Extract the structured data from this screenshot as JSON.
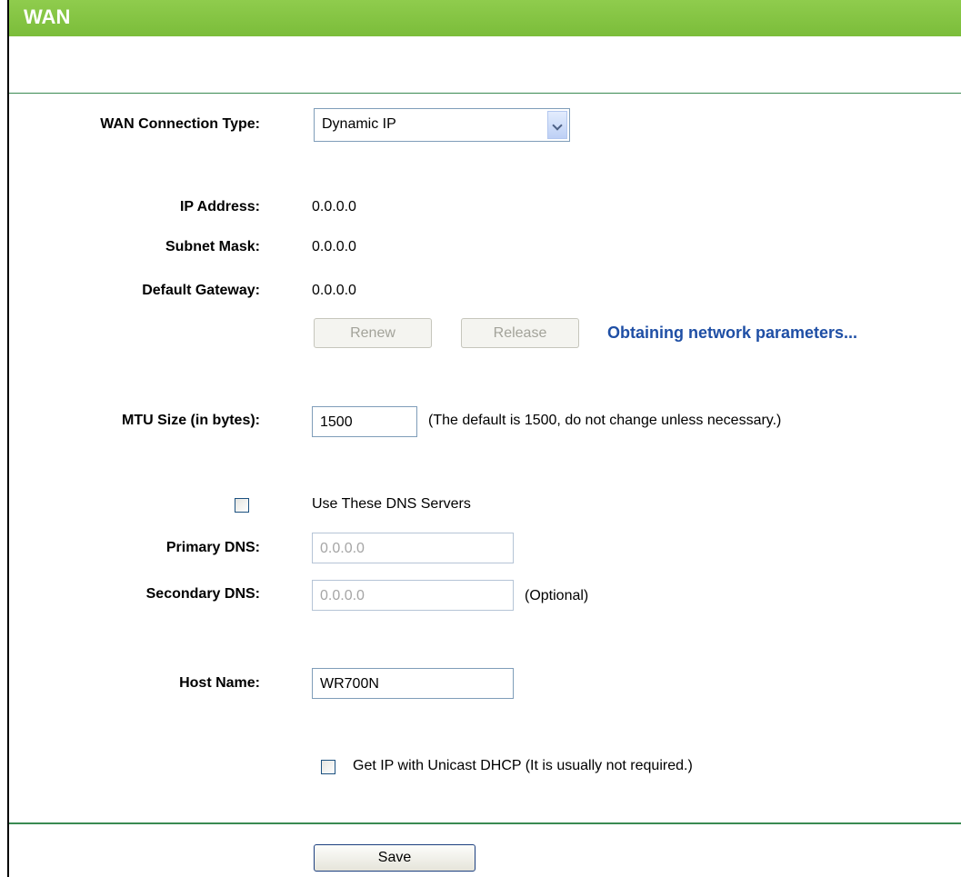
{
  "page": {
    "title": "WAN"
  },
  "connection_type": {
    "label": "WAN Connection Type:",
    "selected": "Dynamic IP"
  },
  "status": {
    "ip_label": "IP Address:",
    "ip_value": "0.0.0.0",
    "mask_label": "Subnet Mask:",
    "mask_value": "0.0.0.0",
    "gateway_label": "Default Gateway:",
    "gateway_value": "0.0.0.0",
    "renew_label": "Renew",
    "release_label": "Release",
    "message": "Obtaining network parameters..."
  },
  "mtu": {
    "label": "MTU Size (in bytes):",
    "value": "1500",
    "hint": "(The default is 1500, do not change unless necessary.)"
  },
  "dns": {
    "use_label": "Use These DNS Servers",
    "use_checked": false,
    "primary_label": "Primary DNS:",
    "primary_value": "0.0.0.0",
    "secondary_label": "Secondary DNS:",
    "secondary_value": "0.0.0.0",
    "optional_label": "(Optional)"
  },
  "host": {
    "label": "Host Name:",
    "value": "WR700N"
  },
  "unicast": {
    "label": "Get IP with Unicast DHCP (It is usually not required.)",
    "checked": false
  },
  "actions": {
    "save_label": "Save"
  }
}
